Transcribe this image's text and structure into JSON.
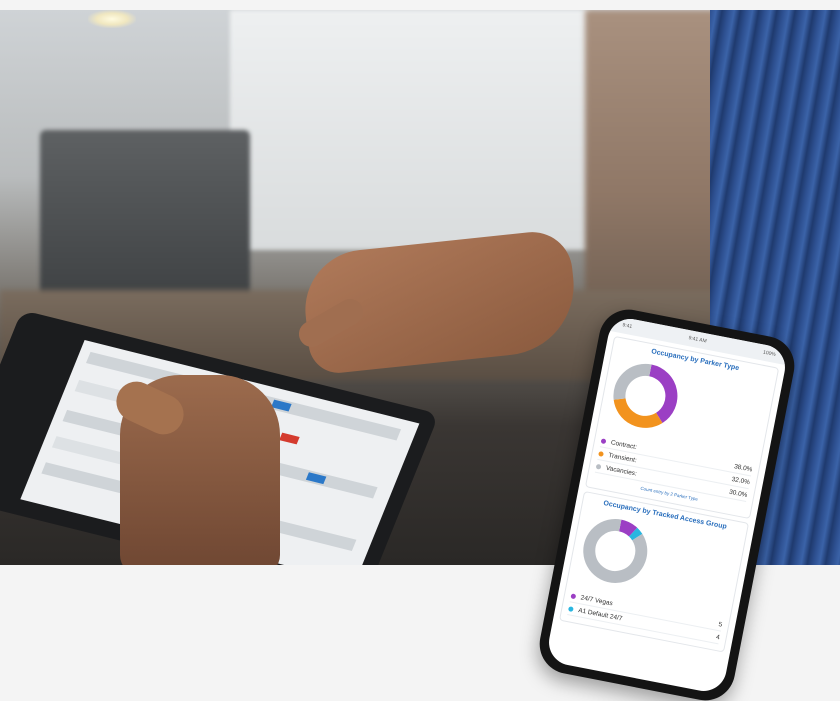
{
  "phone": {
    "status_left": "9:41",
    "status_center": "9:41 AM",
    "status_right": "100%",
    "occupancy_by_parker_type": {
      "title": "Occupancy by Parker Type",
      "legend": [
        {
          "label": "Contract:",
          "value": "38.0%",
          "color": "#9b3fc4"
        },
        {
          "label": "Transient:",
          "value": "32.0%",
          "color": "#f2931e"
        },
        {
          "label": "Vacancies:",
          "value": "30.0%",
          "color": "#b9bec4"
        }
      ],
      "link": "Count entry by 2 Parker Type"
    },
    "occupancy_by_tracked_access_group": {
      "title": "Occupancy by Tracked Access Group",
      "legend": [
        {
          "label": "24/7 Vegas",
          "value": "5",
          "color": "#9b3fc4"
        },
        {
          "label": "A1 Default 24/7",
          "value": "4",
          "color": "#29b6e0"
        }
      ]
    }
  },
  "chart_data": [
    {
      "type": "pie",
      "title": "Occupancy by Parker Type",
      "categories": [
        "Contract:",
        "Transient:",
        "Vacancies:"
      ],
      "values": [
        38.0,
        32.0,
        30.0
      ]
    },
    {
      "type": "pie",
      "title": "Occupancy by Tracked Access Group",
      "categories": [
        "24/7 Vegas",
        "A1 Default 24/7",
        "Vacancies"
      ],
      "values": [
        9,
        4,
        87
      ]
    }
  ],
  "colors": {
    "contract": "#9b3fc4",
    "transient": "#f2931e",
    "vacancies": "#b9bec4",
    "group2": "#29b6e0",
    "accent": "#2a6fbd"
  }
}
